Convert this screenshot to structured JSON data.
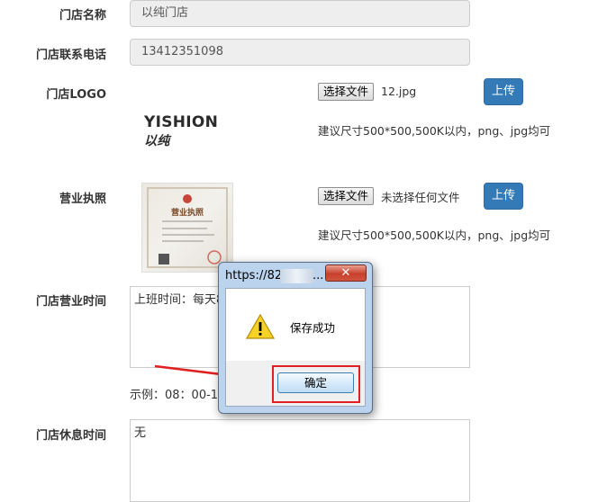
{
  "form": {
    "store_name": {
      "label": "门店名称",
      "value": "以纯门店"
    },
    "store_phone": {
      "label": "门店联系电话",
      "value": "13412351098"
    },
    "store_logo": {
      "label": "门店LOGO",
      "choose_label": "选择文件",
      "file_name": "12.jpg",
      "upload_label": "上传",
      "hint": "建议尺寸500*500,500K以内，png、jpg均可",
      "logo_text_latin": "YISHION",
      "logo_text_cn": "以纯"
    },
    "business_license": {
      "label": "营业执照",
      "choose_label": "选择文件",
      "file_name": "未选择任何文件",
      "upload_label": "上传",
      "hint": "建议尺寸500*500,500K以内，png、jpg均可",
      "image_title": "营业执照"
    },
    "business_hours": {
      "label": "门店营业时间",
      "value": "上班时间：每天8",
      "example": "示例：08：00-10"
    },
    "rest_time": {
      "label": "门店休息时间",
      "value": "无"
    }
  },
  "dialog": {
    "title": "https://82",
    "title_suffix": "...",
    "close_symbol": "✕",
    "icon": "warning-icon",
    "message": "保存成功",
    "ok_label": "确定"
  },
  "colors": {
    "primary_button": "#337ab7",
    "highlight_red": "#e02020",
    "readonly_bg": "#eeeeee"
  }
}
